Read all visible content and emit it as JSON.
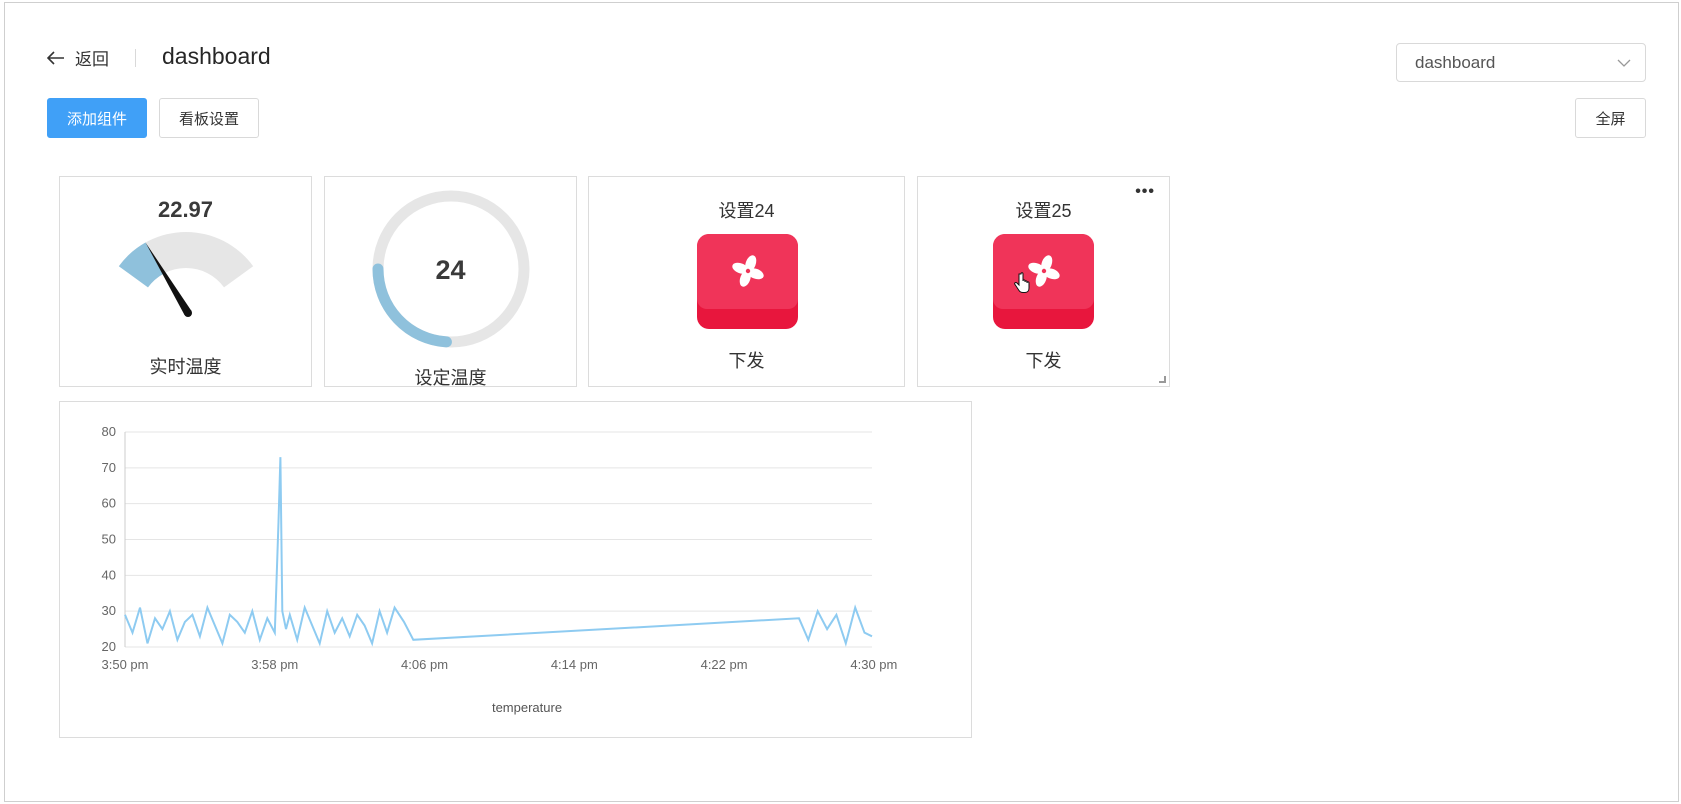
{
  "header": {
    "back_label": "返回",
    "title": "dashboard",
    "board_select": {
      "value": "dashboard"
    }
  },
  "toolbar": {
    "add_widget_label": "添加组件",
    "board_settings_label": "看板设置",
    "fullscreen_label": "全屏"
  },
  "colors": {
    "primary": "#40a0f7",
    "gauge_fill": "#8fc1dc",
    "gauge_track": "#e6e6e6",
    "fan_button": "#f03459",
    "line": "#8ecbf1"
  },
  "widgets": {
    "realtime_temp": {
      "value": "22.97",
      "label": "实时温度",
      "min": 0,
      "max": 100
    },
    "set_temp": {
      "value": "24",
      "label": "设定温度",
      "min": 0,
      "max": 100
    },
    "button24": {
      "title": "设置24",
      "label": "下发",
      "icon": "fan-icon"
    },
    "button25": {
      "title": "设置25",
      "label": "下发",
      "icon": "fan-icon",
      "more_icon": "ellipsis-icon"
    }
  },
  "chart_data": {
    "type": "line",
    "xlabel": "temperature",
    "ylim": [
      20,
      80
    ],
    "yticks": [
      "20",
      "30",
      "40",
      "50",
      "60",
      "70",
      "80"
    ],
    "x_ticks": [
      "3:50 pm",
      "3:58 pm",
      "4:06 pm",
      "4:14 pm",
      "4:22 pm",
      "4:30 pm"
    ],
    "grid": true,
    "series": [
      {
        "x_minutes": [
          0.0,
          0.4,
          0.8,
          1.2,
          1.6,
          2.0,
          2.4,
          2.8,
          3.2,
          3.6,
          4.0,
          4.4,
          4.8,
          5.2,
          5.6,
          6.0,
          6.4,
          6.8,
          7.2,
          7.6,
          8.0,
          8.2,
          8.3,
          8.4,
          8.6,
          8.8,
          9.2,
          9.6,
          10.0,
          10.4,
          10.8,
          11.2,
          11.6,
          12.0,
          12.4,
          12.8,
          13.2,
          13.6,
          14.0,
          14.4,
          14.9,
          15.4,
          36.0,
          36.5,
          37.0,
          37.5,
          38.0,
          38.5,
          39.0,
          39.5,
          39.9
        ],
        "values": [
          29,
          24,
          31,
          21,
          28,
          25,
          30,
          22,
          27,
          29,
          23,
          31,
          26,
          21,
          29,
          27,
          24,
          30,
          22,
          28,
          24,
          55,
          73,
          30,
          25,
          29,
          22,
          31,
          26,
          21,
          30,
          24,
          28,
          23,
          29,
          26,
          21,
          30,
          24,
          31,
          27,
          22,
          28,
          22,
          30,
          25,
          29,
          21,
          31,
          24,
          23
        ]
      }
    ]
  }
}
